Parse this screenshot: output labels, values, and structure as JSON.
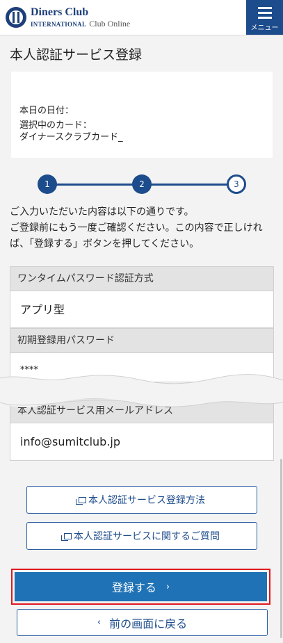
{
  "header": {
    "brand_name": "Diners Club",
    "brand_sub": "INTERNATIONAL",
    "brand_tag": "Club Online",
    "menu_label": "メニュー"
  },
  "page": {
    "title": "本人認証サービス登録"
  },
  "info": {
    "date_label": "本日の日付：",
    "card_label": "選択中のカード：",
    "card_name": "ダイナースクラブカード_"
  },
  "steps": {
    "items": [
      "1",
      "2",
      "3"
    ],
    "current": 3
  },
  "intro": {
    "line1": "ご入力いただいた内容は以下の通りです。",
    "line2": "ご登録前にもう一度ご確認ください。この内容で正しければ、「登録する」ボタンを押してください。"
  },
  "fields": {
    "otp_method_label": "ワンタイムパスワード認証方式",
    "otp_method_value": "アプリ型",
    "initial_password_label": "初期登録用パスワード",
    "initial_password_value": "****",
    "email_label": "本人認証サービス用メールアドレス",
    "email_value": "info@sumitclub.jp"
  },
  "links": {
    "how_to_register": "本人認証サービス登録方法",
    "faq": "本人認証サービスに関するご質問"
  },
  "actions": {
    "register": "登録する",
    "register_chevron": "›",
    "back": "前の画面に戻る",
    "back_chevron": "‹"
  }
}
